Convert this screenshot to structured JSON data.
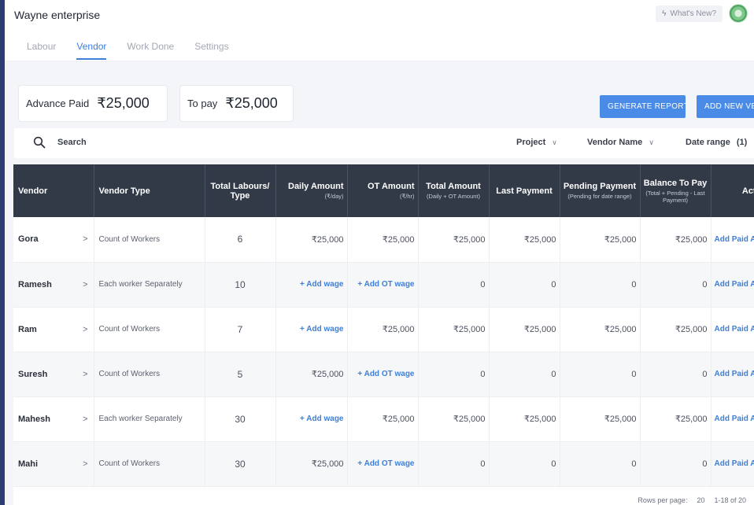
{
  "app": {
    "title": "Wayne enterprise",
    "whats_new": "What's New?"
  },
  "tabs": [
    "Labour",
    "Vendor",
    "Work Done",
    "Settings"
  ],
  "summary": {
    "advance_paid_label": "Advance Paid",
    "advance_paid_value": "₹25,000",
    "to_pay_label": "To pay",
    "to_pay_value": "₹25,000"
  },
  "actions": {
    "generate_report": "GENERATE REPORT",
    "add_new_vendor": "ADD NEW VENDOR"
  },
  "filters": {
    "search": "Search",
    "project": "Project",
    "vendor_name": "Vendor Name",
    "date_range": "Date range",
    "date_range_count": "(1)"
  },
  "table": {
    "headers": [
      {
        "label": "Vendor",
        "sub": ""
      },
      {
        "label": "Vendor Type",
        "sub": ""
      },
      {
        "label": "Total Labours/ Type",
        "sub": ""
      },
      {
        "label": "Daily Amount",
        "sub": "(₹/day)"
      },
      {
        "label": "OT Amount",
        "sub": "(₹/hr)"
      },
      {
        "label": "Total Amount",
        "sub": "(Daily + OT Amount)"
      },
      {
        "label": "Last Payment",
        "sub": ""
      },
      {
        "label": "Pending Payment",
        "sub": "(Pending for date range)"
      },
      {
        "label": "Balance To Pay",
        "sub": "(Total + Pending - Last Payment)"
      },
      {
        "label": "Action",
        "sub": ""
      }
    ],
    "rows": [
      {
        "vendor": "Gora",
        "type": "Count of Workers",
        "labours": "6",
        "daily": "₹25,000",
        "ot": "₹25,000",
        "total": "₹25,000",
        "last": "₹25,000",
        "pending": "₹25,000",
        "balance": "₹25,000",
        "action": "Add Paid Amount"
      },
      {
        "vendor": "Ramesh",
        "type": "Each worker Separately",
        "labours": "10",
        "daily": "+ Add wage",
        "ot": "+ Add OT wage",
        "total": "0",
        "last": "0",
        "pending": "0",
        "balance": "0",
        "action": "Add Paid Amount"
      },
      {
        "vendor": "Ram",
        "type": "Count of Workers",
        "labours": "7",
        "daily": "+ Add wage",
        "ot": "₹25,000",
        "total": "₹25,000",
        "last": "₹25,000",
        "pending": "₹25,000",
        "balance": "₹25,000",
        "action": "Add Paid Amount"
      },
      {
        "vendor": "Suresh",
        "type": "Count of Workers",
        "labours": "5",
        "daily": "₹25,000",
        "ot": "+ Add OT wage",
        "total": "0",
        "last": "0",
        "pending": "0",
        "balance": "0",
        "action": "Add Paid Amount"
      },
      {
        "vendor": "Mahesh",
        "type": "Each worker Separately",
        "labours": "30",
        "daily": "+ Add wage",
        "ot": "₹25,000",
        "total": "₹25,000",
        "last": "₹25,000",
        "pending": "₹25,000",
        "balance": "₹25,000",
        "action": "Add Paid Amount"
      },
      {
        "vendor": "Mahi",
        "type": "Count of Workers",
        "labours": "30",
        "daily": "₹25,000",
        "ot": "+ Add OT wage",
        "total": "0",
        "last": "0",
        "pending": "0",
        "balance": "0",
        "action": "Add Paid Amount"
      }
    ]
  },
  "pagination": {
    "rows_per_page_label": "Rows per page:",
    "rows_per_page_value": "20",
    "range": "1-18 of 20"
  },
  "colors": {
    "accent": "#4b8be8",
    "header_bg": "#323a48",
    "link": "#3d7fd9"
  }
}
